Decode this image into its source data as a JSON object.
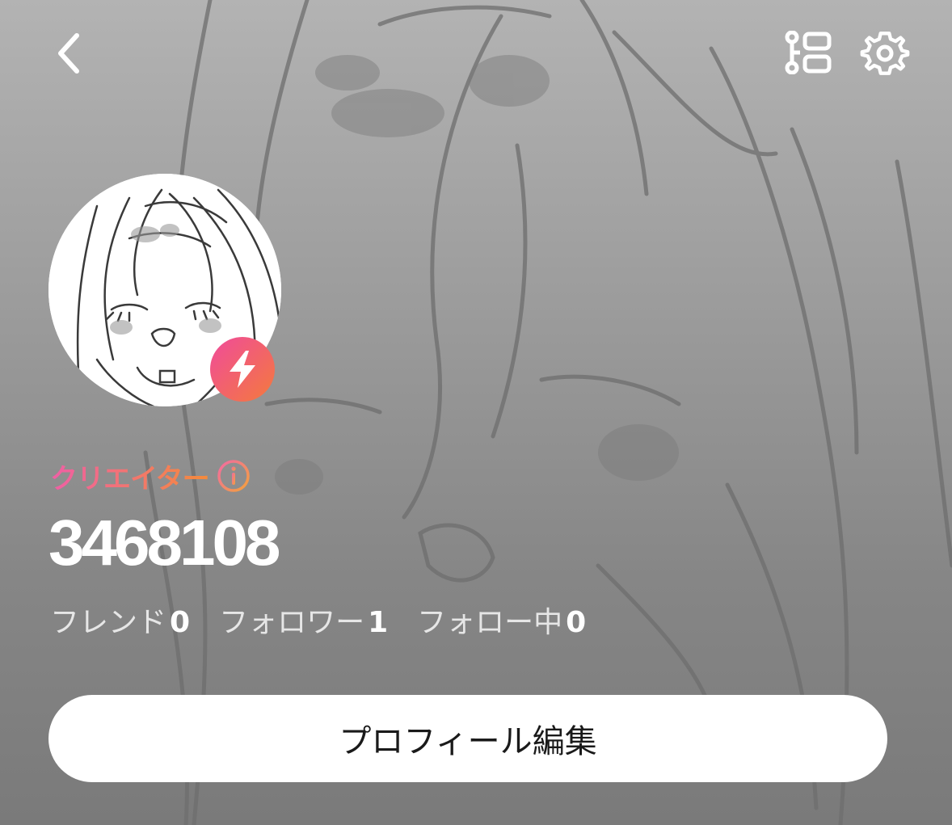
{
  "topbar": {
    "back_icon": "chevron-left-icon",
    "layout_icon": "layout-list-icon",
    "settings_icon": "gear-icon"
  },
  "profile": {
    "avatar_description": "avatar",
    "badge_icon": "lightning-bolt-icon",
    "role_label": "クリエイター",
    "role_info_icon": "info-icon",
    "user_id": "3468108",
    "stats": [
      {
        "label": "フレンド",
        "value": "0"
      },
      {
        "label": "フォロワー",
        "value": "1"
      },
      {
        "label": "フォロー中",
        "value": "0"
      }
    ],
    "edit_button_label": "プロフィール編集"
  },
  "colors": {
    "accent_gradient_start": "#f04b9b",
    "accent_gradient_end": "#f47a3c",
    "background_gray": "#9d9d9d"
  }
}
